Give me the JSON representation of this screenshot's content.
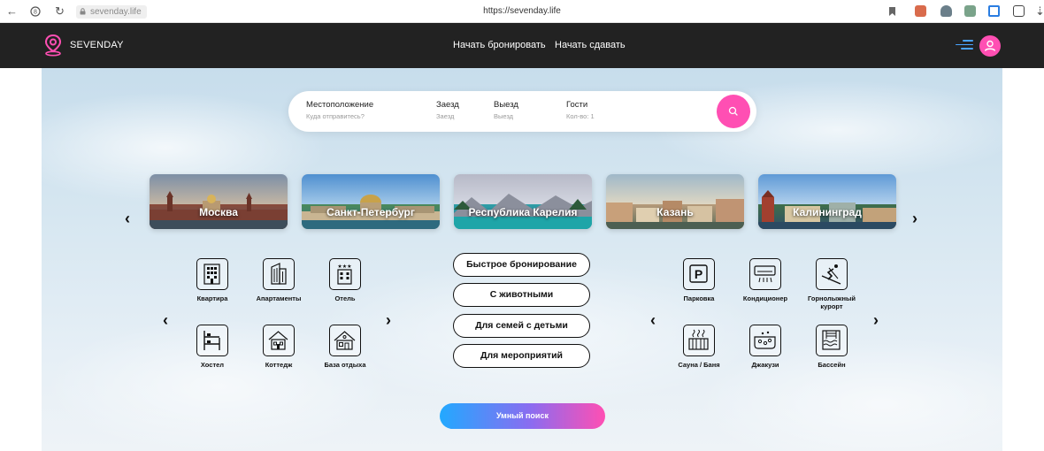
{
  "browser": {
    "url_short": "sevenday.life",
    "url_full": "https://sevenday.life"
  },
  "header": {
    "brand": "SEVENDAY",
    "nav": [
      "Начать бронировать",
      "Начать сдавать"
    ]
  },
  "search": {
    "location_label": "Местоположение",
    "location_placeholder": "Куда отправитесь?",
    "checkin_label": "Заезд",
    "checkin_placeholder": "Заезд",
    "checkout_label": "Выезд",
    "checkout_placeholder": "Выезд",
    "guests_label": "Гости",
    "guests_placeholder": "Кол-во: 1"
  },
  "cities": [
    "Москва",
    "Санкт-Петербург",
    "Республика Карелия",
    "Казань",
    "Калининград"
  ],
  "property_types": [
    "Квартира",
    "Апартаменты",
    "Отель",
    "Хостел",
    "Коттедж",
    "База отдыха"
  ],
  "filters": [
    "Быстрое бронирование",
    "С животными",
    "Для семей с детьми",
    "Для мероприятий"
  ],
  "amenities": [
    "Парковка",
    "Кондиционер",
    "Горнолыжный курорт",
    "Сауна / Баня",
    "Джакузи",
    "Бассейн"
  ],
  "smart_search": "Умный поиск",
  "colors": {
    "accent_pink": "#ff4fb3",
    "header_bg": "#222222",
    "accent_blue": "#22a9ff"
  }
}
